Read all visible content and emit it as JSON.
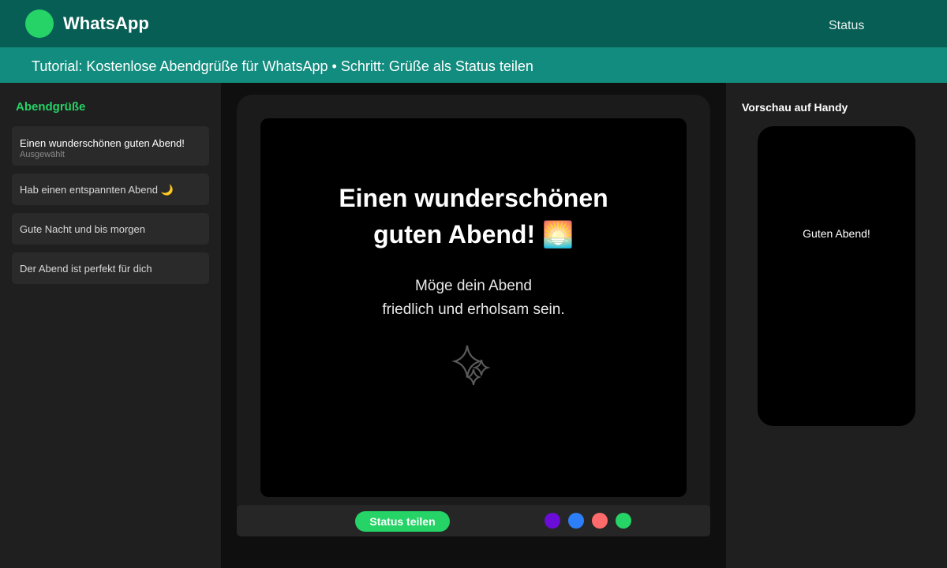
{
  "app": {
    "brand": "WhatsApp",
    "nav_status": "Status"
  },
  "tutorial": {
    "text": "Tutorial: Kostenlose Abendgrüße für WhatsApp • Schritt: Grüße als Status teilen"
  },
  "sidebar": {
    "title": "Abendgrüße",
    "items": [
      {
        "label": "Einen wunderschönen guten Abend!",
        "sub": "Ausgewählt",
        "selected": true
      },
      {
        "label": "Hab einen entspannten Abend 🌙",
        "selected": false
      },
      {
        "label": "Gute Nacht und bis morgen",
        "selected": false
      },
      {
        "label": "Der Abend ist perfekt für dich",
        "selected": false
      }
    ]
  },
  "editor": {
    "title_line1": "Einen wunderschönen",
    "title_line2": "guten Abend! 🌅",
    "body_line1": "Möge dein Abend",
    "body_line2": "friedlich und erholsam sein.",
    "decor_icon": "sparkles-icon",
    "share_label": "Status teilen",
    "swatches": [
      "#6a0dd6",
      "#2d7ff9",
      "#ff6b6b",
      "#25d366"
    ]
  },
  "preview": {
    "title": "Vorschau auf Handy",
    "text": "Guten Abend!"
  },
  "colors": {
    "header": "#075e54",
    "tutorial_bar": "#128c7e",
    "accent": "#25d366"
  }
}
